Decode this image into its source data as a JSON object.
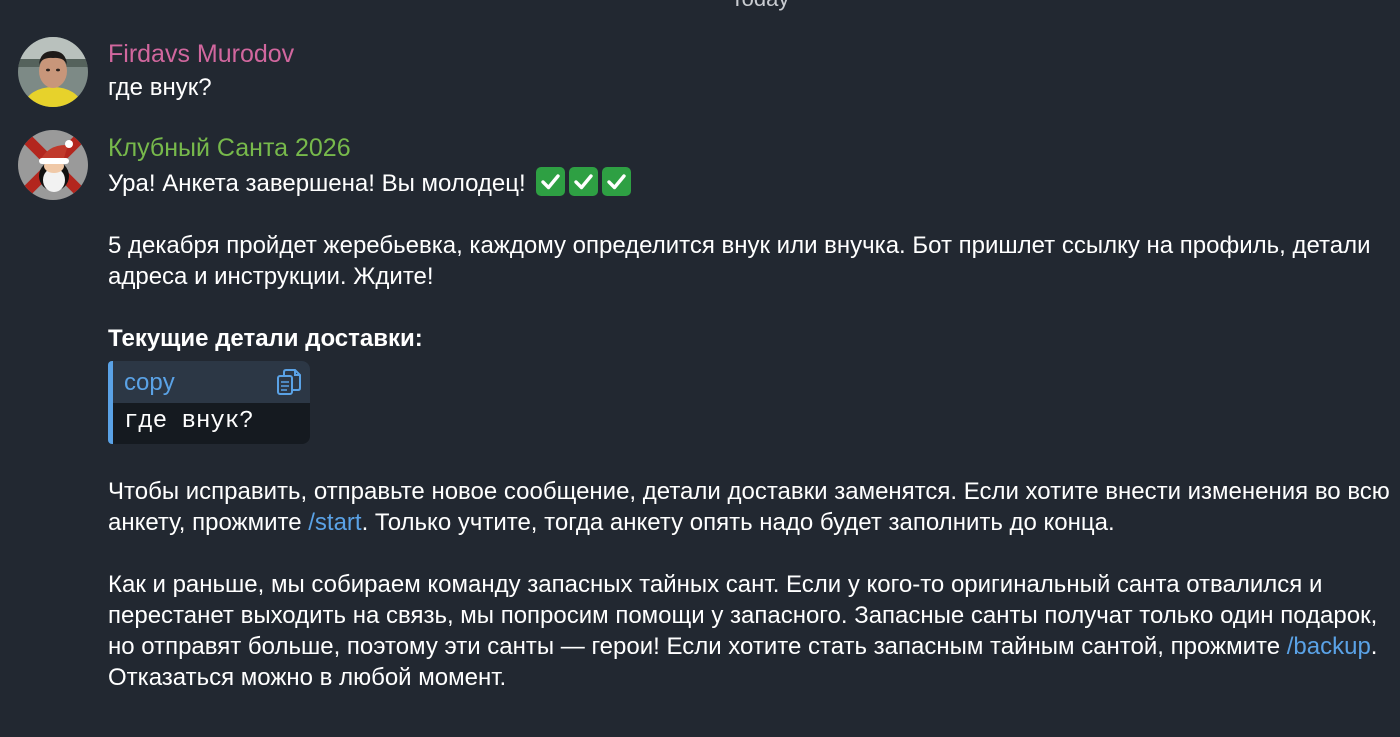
{
  "chat": {
    "date_separator": "Today"
  },
  "messages": [
    {
      "sender": "Firdavs Murodov",
      "sender_color": "#d1679e",
      "text": "где внук?"
    },
    {
      "sender": "Клубный Санта 2026",
      "sender_color": "#77b94b",
      "intro": "Ура! Анкета завершена! Вы молодец!",
      "emoji": [
        "check-mark-button",
        "check-mark-button",
        "check-mark-button"
      ],
      "paragraph1": "5 декабря пройдет жеребьевка, каждому определится внук или внучка. Бот пришлет ссылку на профиль, детали адреса и инструкции. Ждите!",
      "delivery_heading": "Текущие детали доставки:",
      "code_block": {
        "language": "copy",
        "content": "где внук?",
        "icon": "copy-icon"
      },
      "paragraph2_before": "Чтобы исправить, отправьте новое сообщение, детали доставки заменятся. Если хотите внести изменения во всю анкету, прожмите ",
      "paragraph2_link": "/start",
      "paragraph2_after": ". Только учтите, тогда анкету опять надо будет заполнить до конца.",
      "paragraph3_before": "Как и раньше, мы собираем команду запасных тайных сант. Если у кого-то оригинальный санта отвалился и перестанет выходить на связь, мы попросим помощи у запасного. Запасные санты получат только один подарок, но отправят больше, поэтому эти санты — герои! Если хотите стать запасным тайным сантой, прожмите ",
      "paragraph3_link": "/backup",
      "paragraph3_after": ". Отказаться можно в любой момент."
    }
  ],
  "colors": {
    "background": "#222831",
    "link": "#5aa2e6",
    "code_header": "#2c3745",
    "code_body": "#151a20"
  }
}
